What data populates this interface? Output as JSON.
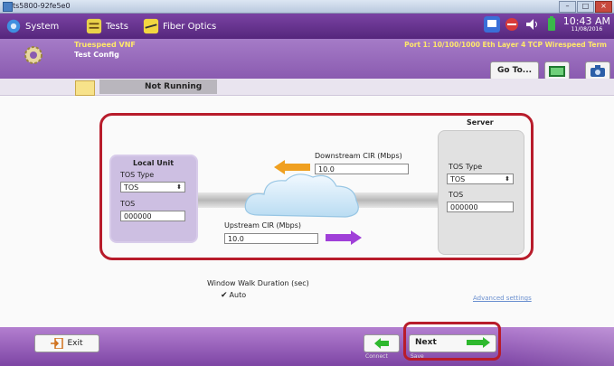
{
  "window": {
    "title": "ts5800-92fe5e0",
    "controls": [
      "–",
      "□",
      "×"
    ]
  },
  "topbar": {
    "tabs": [
      {
        "label": "System",
        "icon": "gear-icon"
      },
      {
        "label": "Tests",
        "icon": "tests-icon"
      },
      {
        "label": "Fiber Optics",
        "icon": "fiber-optics-icon"
      }
    ],
    "clock": {
      "time": "10:43 AM",
      "date": "11/08/2016"
    }
  },
  "header": {
    "test_name": "Truespeed VNF",
    "screen_title": "Test Config",
    "port_info": "Port 1: 10/100/1000 Eth Layer 4 TCP Wirespeed Term",
    "goto_label": "Go To..."
  },
  "status": {
    "text": "Not Running"
  },
  "diagram": {
    "local_unit": {
      "title": "Local Unit",
      "tos_type_label": "TOS Type",
      "tos_type_value": "TOS",
      "tos_label": "TOS",
      "tos_value": "000000"
    },
    "server": {
      "title": "Server",
      "tos_type_label": "TOS Type",
      "tos_type_value": "TOS",
      "tos_label": "TOS",
      "tos_value": "000000"
    },
    "downstream": {
      "label": "Downstream CIR (Mbps)",
      "value": "10.0"
    },
    "upstream": {
      "label": "Upstream CIR (Mbps)",
      "value": "10.0"
    }
  },
  "window_walk": {
    "label": "Window Walk Duration (sec)",
    "auto_label": "Auto",
    "auto_checked": true
  },
  "advanced_link": "Advanced settings",
  "bottom": {
    "exit_label": "Exit",
    "prev_caption": "Connect",
    "next_label": "Next",
    "next_caption": "Save"
  },
  "colors": {
    "purple_dark": "#55267c",
    "purple_light": "#a57bc7",
    "highlight_red": "#b81c2b",
    "arrow_orange": "#f0a020",
    "arrow_violet": "#a040d8",
    "arrow_green": "#2eb82e"
  }
}
